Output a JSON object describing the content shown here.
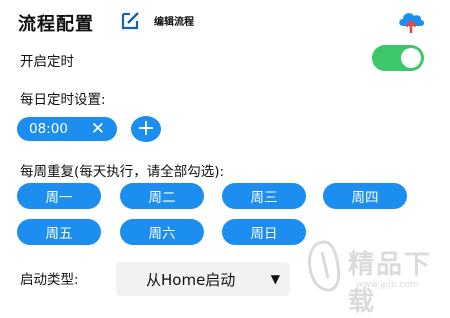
{
  "header": {
    "title": "流程配置",
    "edit_label": "编辑流程",
    "edit_icon": "edit-icon",
    "cloud_icon": "cloud-upload-icon"
  },
  "schedule": {
    "enable_label": "开启定时",
    "enabled": true,
    "daily_label": "每日定时设置:",
    "times": [
      "08:00"
    ],
    "remove_glyph": "✕",
    "add_glyph": "+"
  },
  "weekly": {
    "label": "每周重复(每天执行，请全部勾选):",
    "days": [
      "周一",
      "周二",
      "周三",
      "周四",
      "周五",
      "周六",
      "周日"
    ]
  },
  "launch": {
    "label": "启动类型:",
    "value": "从Home启动",
    "arrow": "▼"
  },
  "watermark": {
    "text": "精品下载",
    "url": "www.jpjb.com"
  },
  "colors": {
    "accent": "#1b8ef0",
    "toggle_on": "#3cc76a",
    "cloud": "#1a90f0",
    "upload_arrow": "#e04848"
  }
}
